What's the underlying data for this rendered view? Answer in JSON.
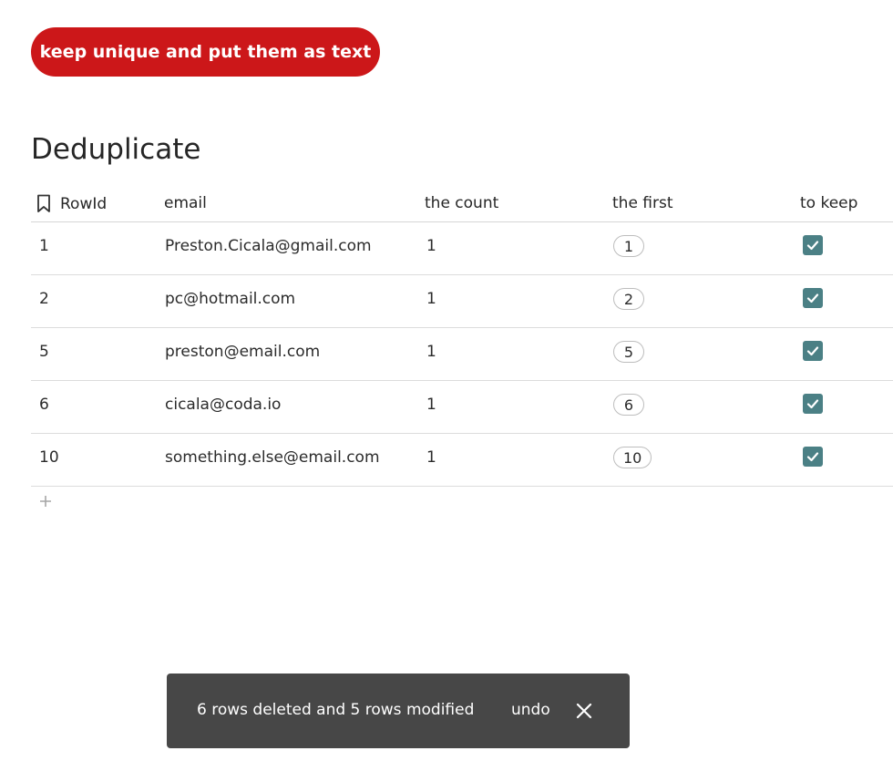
{
  "action_button": {
    "label": "keep unique and put them as text",
    "color": "#cc1719"
  },
  "table": {
    "title": "Deduplicate",
    "columns": [
      "RowId",
      "email",
      "the count",
      "the first",
      "to keep"
    ],
    "rows": [
      {
        "rowid": "1",
        "email": "Preston.Cicala@gmail.com",
        "count": "1",
        "first": "1",
        "keep": true
      },
      {
        "rowid": "2",
        "email": "pc@hotmail.com",
        "count": "1",
        "first": "2",
        "keep": true
      },
      {
        "rowid": "5",
        "email": "preston@email.com",
        "count": "1",
        "first": "5",
        "keep": true
      },
      {
        "rowid": "6",
        "email": "cicala@coda.io",
        "count": "1",
        "first": "6",
        "keep": true
      },
      {
        "rowid": "10",
        "email": "something.else@email.com",
        "count": "1",
        "first": "10",
        "keep": true
      }
    ],
    "checkbox_color": "#4b8085",
    "add_row_icon": "plus-icon"
  },
  "toast": {
    "message": "6 rows deleted and 5 rows modified",
    "undo_label": "undo",
    "close_icon": "close-icon"
  }
}
